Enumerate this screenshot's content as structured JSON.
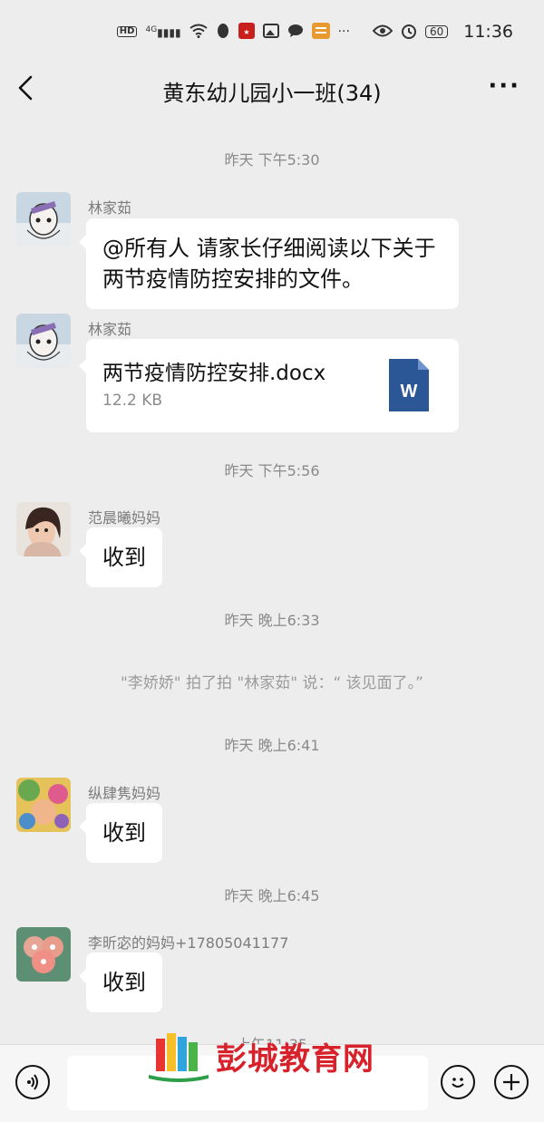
{
  "status_bar": {
    "network": "4G",
    "hd_badge": "HD",
    "battery": "60",
    "clock": "11:36",
    "icons": [
      "hd-icon",
      "signal-icon",
      "wifi-icon",
      "penguin-icon",
      "app-icon",
      "gallery-icon",
      "chat-icon",
      "news-icon",
      "dots-icon",
      "eye-icon",
      "alarm-icon",
      "battery-icon"
    ]
  },
  "header": {
    "title": "黄东幼儿园小一班(34)",
    "more": "···"
  },
  "messages": {
    "t1": "昨天 下午5:30",
    "m1": {
      "sender": "林家茹",
      "text": "@所有人  请家长仔细阅读以下关于两节疫情防控安排的文件。"
    },
    "m2": {
      "sender": "林家茹",
      "file_name": "两节疫情防控安排.docx",
      "file_size": "12.2 KB",
      "file_icon_letter": "W"
    },
    "t2": "昨天 下午5:56",
    "m3": {
      "sender": "范晨曦妈妈",
      "text": "收到"
    },
    "t3": "昨天 晚上6:33",
    "system1": "\"李娇娇\" 拍了拍 \"林家茹\" 说：“ 该见面了。”",
    "t4": "昨天 晚上6:41",
    "m4": {
      "sender": "纵肆隽妈妈",
      "text": "收到"
    },
    "t5": "昨天 晚上6:45",
    "m5": {
      "sender": "李昕宓的妈妈+17805041177",
      "text": "收到"
    },
    "t6": "上午11:35"
  },
  "watermark": {
    "text": "彭城教育网"
  },
  "colors": {
    "background": "#ededed",
    "bubble": "#ffffff",
    "word_blue": "#2b5797",
    "watermark_red": "#d8222b"
  }
}
